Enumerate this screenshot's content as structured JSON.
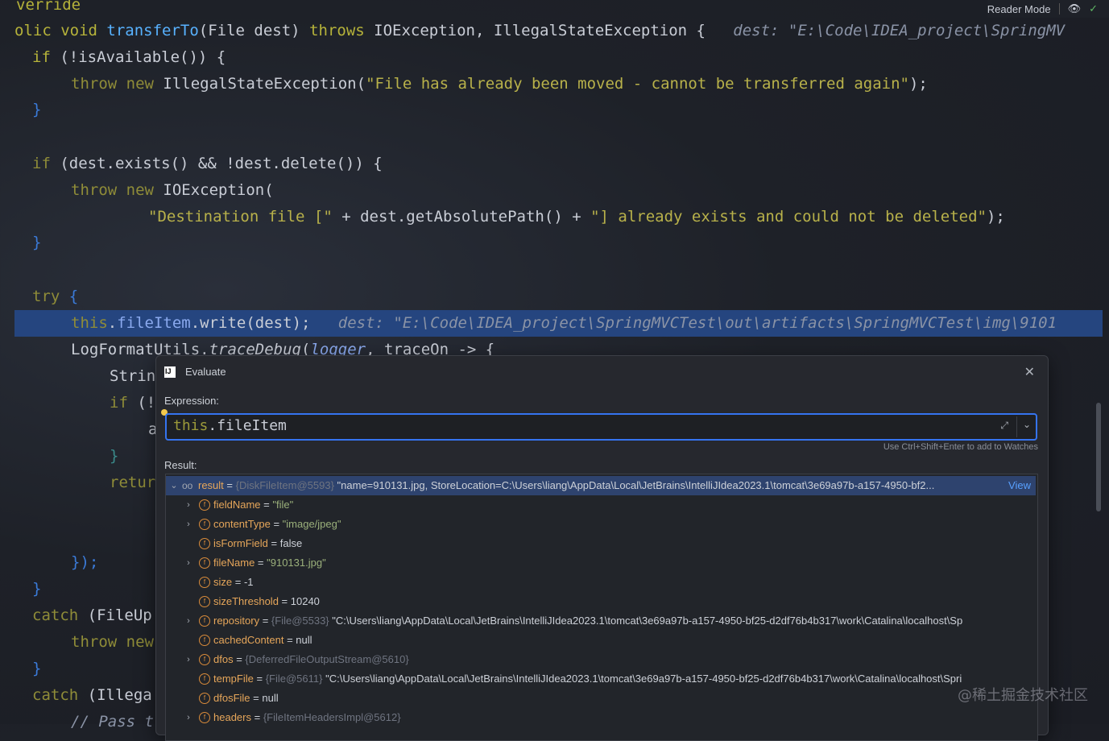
{
  "reader_mode": "Reader Mode",
  "code": {
    "l0": "verride",
    "l1": {
      "a": "olic ",
      "b": "void ",
      "c": "transferTo",
      "d": "(File dest) ",
      "e": "throws ",
      "f": "IOException, IllegalStateException {",
      "hint": "dest: \"E:\\Code\\IDEA_project\\SpringMV"
    },
    "l2": {
      "a": "if ",
      "b": "(!isAvailable()) {"
    },
    "l3": {
      "a": "throw new ",
      "b": "IllegalStateException(",
      "c": "\"File has already been moved - cannot be transferred again\"",
      "d": ");"
    },
    "l4": "}",
    "l6": {
      "a": "if ",
      "b": "(dest.exists() && !dest.delete()) {"
    },
    "l7": {
      "a": "throw new ",
      "b": "IOException("
    },
    "l8": {
      "a": "\"Destination file [\" ",
      "b": "+ dest.getAbsolutePath() + ",
      "c": "\"] already exists and could not be deleted\"",
      "d": ");"
    },
    "l9": "}",
    "l11": {
      "a": "try ",
      "b": "{"
    },
    "l12": {
      "a": "this",
      "b": ".",
      "c": "fileItem",
      "d": ".write(dest);",
      "hint": "dest: \"E:\\Code\\IDEA_project\\SpringMVCTest\\out\\artifacts\\SpringMVCTest\\img\\9101"
    },
    "l13": {
      "a": "LogFormatUtils.",
      "b": "traceDebug",
      "c": "(",
      "d": "logger",
      "e": ", traceOn -> {"
    },
    "l14": "Strin",
    "l15": {
      "a": "if ",
      "b": "(!"
    },
    "l16": "a",
    "l17": "}",
    "l18": "retur",
    "l20": "});",
    "l21": "}",
    "l22": {
      "a": "catch ",
      "b": "(FileUp"
    },
    "l23": {
      "a": "throw new"
    },
    "l24": "}",
    "l25": {
      "a": "catch ",
      "b": "(Illega"
    },
    "l26": "// Pass t"
  },
  "dialog": {
    "title": "Evaluate",
    "expression_label": "Expression:",
    "expression": {
      "kw": "this",
      "rest": ".fileItem"
    },
    "hint": "Use Ctrl+Shift+Enter to add to Watches",
    "result_label": "Result:",
    "rows": [
      {
        "name": "result",
        "eq": " = ",
        "type": "{DiskFileItem@5593} ",
        "value": "\"name=910131.jpg, StoreLocation=C:\\Users\\liang\\AppData\\Local\\JetBrains\\IntelliJIdea2023.1\\tomcat\\3e69a97b-a157-4950-bf2...",
        "link": "View"
      },
      {
        "name": "fieldName",
        "eq": " = ",
        "value": "\"file\""
      },
      {
        "name": "contentType",
        "eq": " = ",
        "value": "\"image/jpeg\""
      },
      {
        "name": "isFormField",
        "eq": " = ",
        "value": "false"
      },
      {
        "name": "fileName",
        "eq": " = ",
        "value": "\"910131.jpg\""
      },
      {
        "name": "size",
        "eq": " = ",
        "value": "-1"
      },
      {
        "name": "sizeThreshold",
        "eq": " = ",
        "value": "10240"
      },
      {
        "name": "repository",
        "eq": " = ",
        "type": "{File@5533} ",
        "value": "\"C:\\Users\\liang\\AppData\\Local\\JetBrains\\IntelliJIdea2023.1\\tomcat\\3e69a97b-a157-4950-bf25-d2df76b4b317\\work\\Catalina\\localhost\\Sp"
      },
      {
        "name": "cachedContent",
        "eq": " = ",
        "value": "null"
      },
      {
        "name": "dfos",
        "eq": " = ",
        "type": "{DeferredFileOutputStream@5610}"
      },
      {
        "name": "tempFile",
        "eq": " = ",
        "type": "{File@5611} ",
        "value": "\"C:\\Users\\liang\\AppData\\Local\\JetBrains\\IntelliJIdea2023.1\\tomcat\\3e69a97b-a157-4950-bf25-d2df76b4b317\\work\\Catalina\\localhost\\Spri"
      },
      {
        "name": "dfosFile",
        "eq": " = ",
        "value": "null"
      },
      {
        "name": "headers",
        "eq": " = ",
        "type": "{FileItemHeadersImpl@5612}"
      }
    ]
  },
  "watermark": "@稀土掘金技术社区"
}
